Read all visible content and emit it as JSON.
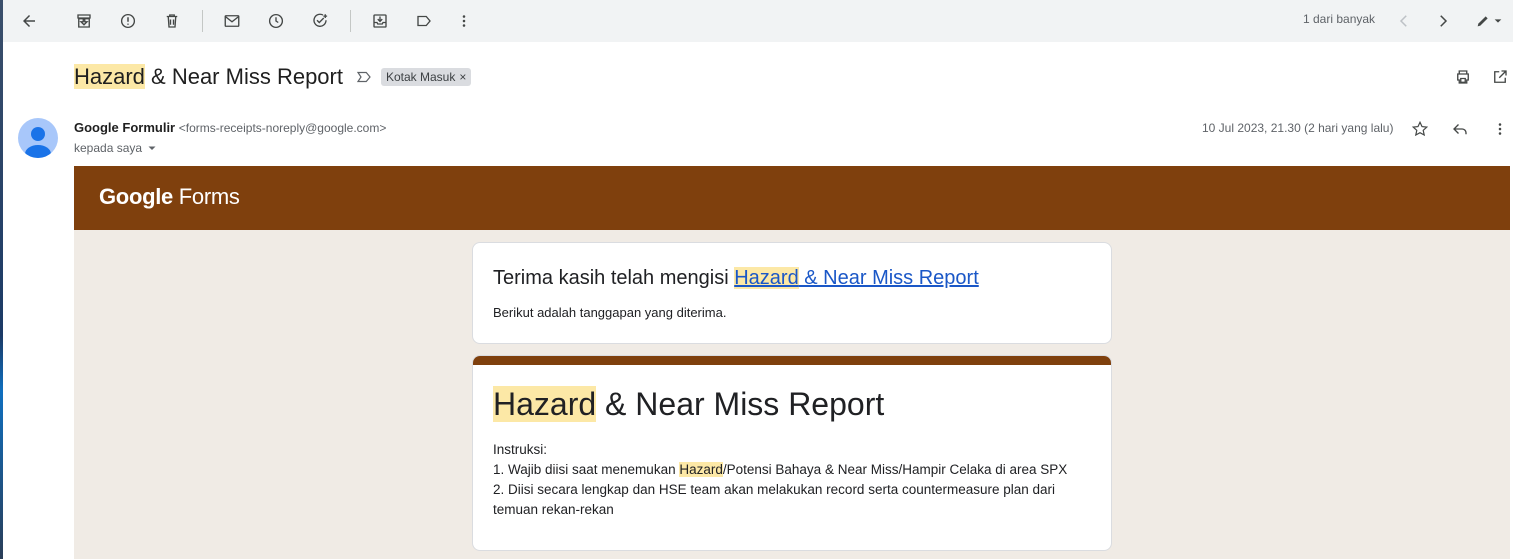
{
  "toolbar": {
    "pager_text": "1 dari banyak",
    "icons": [
      "back-arrow-icon",
      "archive-icon",
      "report-spam-icon",
      "delete-icon",
      "mark-unread-icon",
      "snooze-icon",
      "add-task-icon",
      "move-to-icon",
      "label-icon",
      "more-vert-icon",
      "prev-icon",
      "next-icon",
      "edit-icon"
    ]
  },
  "subject": {
    "highlight": "Hazard",
    "rest": " & Near Miss Report",
    "label_chip": "Kotak Masuk",
    "chip_close": "×"
  },
  "message": {
    "sender_name": "Google Formulir",
    "sender_email": "<forms-receipts-noreply@google.com>",
    "to_text": "kepada saya",
    "date": "10 Jul 2023, 21.30 (2 hari yang lalu)"
  },
  "forms": {
    "logo_google": "Google",
    "logo_forms": "Forms",
    "brand_color": "#7f400d",
    "thanks_prefix": "Terima kasih telah mengisi ",
    "thanks_link_highlight": "Hazard",
    "thanks_link_rest": " & Near Miss Report ",
    "thanks_sub": "Berikut adalah tanggapan yang diterima.",
    "form_title_highlight": "Hazard",
    "form_title_rest": " & Near Miss Report",
    "instr_heading": "Instruksi:",
    "instr_1_prefix": "1. Wajib diisi saat menemukan ",
    "instr_1_highlight": "Hazard",
    "instr_1_rest": "/Potensi Bahaya & Near Miss/Hampir Celaka di area SPX",
    "instr_2": "2. Diisi secara lengkap dan HSE team akan melakukan record serta countermeasure plan dari temuan rekan-rekan"
  }
}
